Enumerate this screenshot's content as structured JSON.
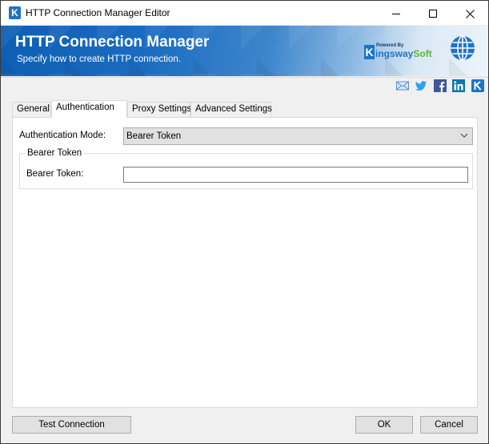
{
  "window": {
    "title": "HTTP Connection Manager Editor",
    "app_icon_letter": "K",
    "controls": {
      "minimize": "minimize-icon",
      "maximize": "maximize-icon",
      "close": "close-icon"
    }
  },
  "banner": {
    "title": "HTTP Connection Manager",
    "subtitle": "Specify how to create HTTP connection.",
    "brand": {
      "powered_by": "Powered By",
      "k": "K",
      "name_part1": "ingsway",
      "name_part2": "Soft"
    },
    "globe_icon": "globe-icon"
  },
  "social_links": [
    "email-icon",
    "twitter-icon",
    "facebook-icon",
    "linkedin-icon",
    "kingswaysoft-icon"
  ],
  "tabs": [
    {
      "label": "General",
      "active": false
    },
    {
      "label": "Authentication",
      "active": true
    },
    {
      "label": "Proxy Settings",
      "active": false
    },
    {
      "label": "Advanced Settings",
      "active": false
    }
  ],
  "authentication": {
    "mode_label": "Authentication Mode:",
    "mode_value": "Bearer Token",
    "group_title": "Bearer Token",
    "token_label": "Bearer Token:",
    "token_value": "",
    "token_placeholder": ""
  },
  "footer": {
    "test_connection": "Test Connection",
    "ok": "OK",
    "cancel": "Cancel"
  },
  "colors": {
    "brand_blue": "#1e73c8",
    "brand_green": "#5fb43a",
    "dialog_bg": "#f0f0f0"
  }
}
